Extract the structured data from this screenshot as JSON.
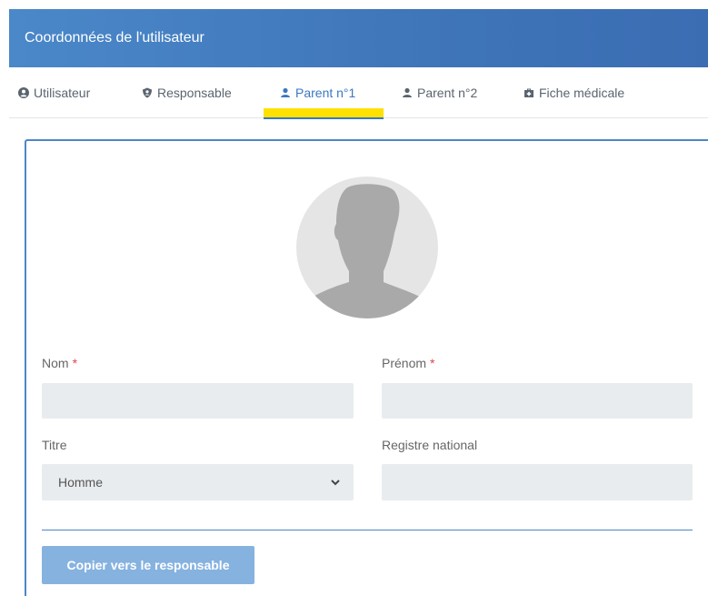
{
  "header": {
    "title": "Coordonnées de l'utilisateur"
  },
  "tabs": [
    {
      "label": "Utilisateur",
      "icon": "user-circle-icon"
    },
    {
      "label": "Responsable",
      "icon": "user-shield-icon"
    },
    {
      "label": "Parent n°1",
      "icon": "user-icon",
      "active": true
    },
    {
      "label": "Parent n°2",
      "icon": "user-icon"
    },
    {
      "label": "Fiche médicale",
      "icon": "medical-kit-icon"
    }
  ],
  "colors": {
    "header": "#3f75b9",
    "accent": "#3b78c2",
    "highlight": "#ffe100",
    "required": "#e0464a",
    "button": "#86b2e0"
  },
  "form": {
    "nom_label": "Nom",
    "prenom_label": "Prénom",
    "required_mark": "*",
    "titre_label": "Titre",
    "titre_value": "Homme",
    "registre_label": "Registre national",
    "nom_value": "",
    "prenom_value": "",
    "registre_value": ""
  },
  "actions": {
    "copy_label": "Copier vers le responsable"
  }
}
